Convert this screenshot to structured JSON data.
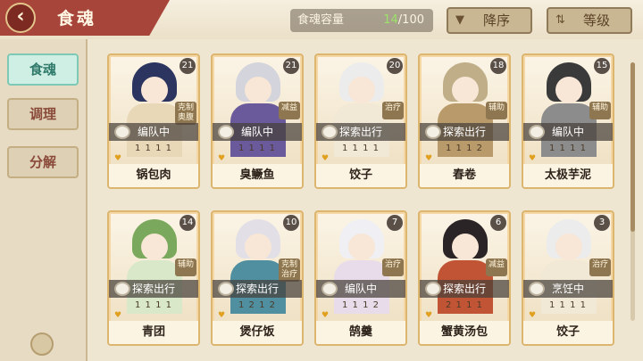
{
  "header": {
    "title": "食魂",
    "capacity_label": "食魂容量",
    "capacity_current": "14",
    "capacity_total": "/100",
    "sort_order_label": "降序",
    "sort_key_label": "等级"
  },
  "sidebar": {
    "items": [
      {
        "label": "食魂",
        "active": true
      },
      {
        "label": "调理",
        "active": false
      },
      {
        "label": "分解",
        "active": false
      }
    ]
  },
  "cards": [
    {
      "name": "锅包肉",
      "level": "21",
      "role": "克制 奥腹",
      "status": "编队中",
      "stats": "1 1 1 1",
      "hair": "#2c3560",
      "body": "#e9d8b8"
    },
    {
      "name": "臭鳜鱼",
      "level": "21",
      "role": "减益",
      "status": "编队中",
      "stats": "1 1 1 1",
      "hair": "#d4d4dc",
      "body": "#6a5a9c"
    },
    {
      "name": "饺子",
      "level": "20",
      "role": "治疗",
      "status": "探索出行",
      "stats": "1 1 1 1",
      "hair": "#ececec",
      "body": "#f1e9d6"
    },
    {
      "name": "春卷",
      "level": "18",
      "role": "辅助",
      "status": "探索出行",
      "stats": "1 1 1 2",
      "hair": "#bfae88",
      "body": "#b99a6a"
    },
    {
      "name": "太极芋泥",
      "level": "15",
      "role": "辅助",
      "status": "编队中",
      "stats": "1 1 1 1",
      "hair": "#3a3a3a",
      "body": "#8c8c8c"
    },
    {
      "name": "青团",
      "level": "14",
      "role": "辅助",
      "status": "探索出行",
      "stats": "1 1 1 1",
      "hair": "#7aa85c",
      "body": "#d8e8c8"
    },
    {
      "name": "煲仔饭",
      "level": "10",
      "role": "克制 治疗",
      "status": "探索出行",
      "stats": "1 2 1 2",
      "hair": "#e2e0e6",
      "body": "#4f8fa0"
    },
    {
      "name": "鹄羹",
      "level": "7",
      "role": "治疗",
      "status": "编队中",
      "stats": "1 1 1 2",
      "hair": "#f0f0f4",
      "body": "#e8dcea"
    },
    {
      "name": "蟹黄汤包",
      "level": "6",
      "role": "减益",
      "status": "探索出行",
      "stats": "2 1 1 1",
      "hair": "#2a2426",
      "body": "#c05434"
    },
    {
      "name": "饺子",
      "level": "3",
      "role": "治疗",
      "status": "烹饪中",
      "stats": "1 1 1 1",
      "hair": "#ececec",
      "body": "#f1e9d6"
    }
  ]
}
